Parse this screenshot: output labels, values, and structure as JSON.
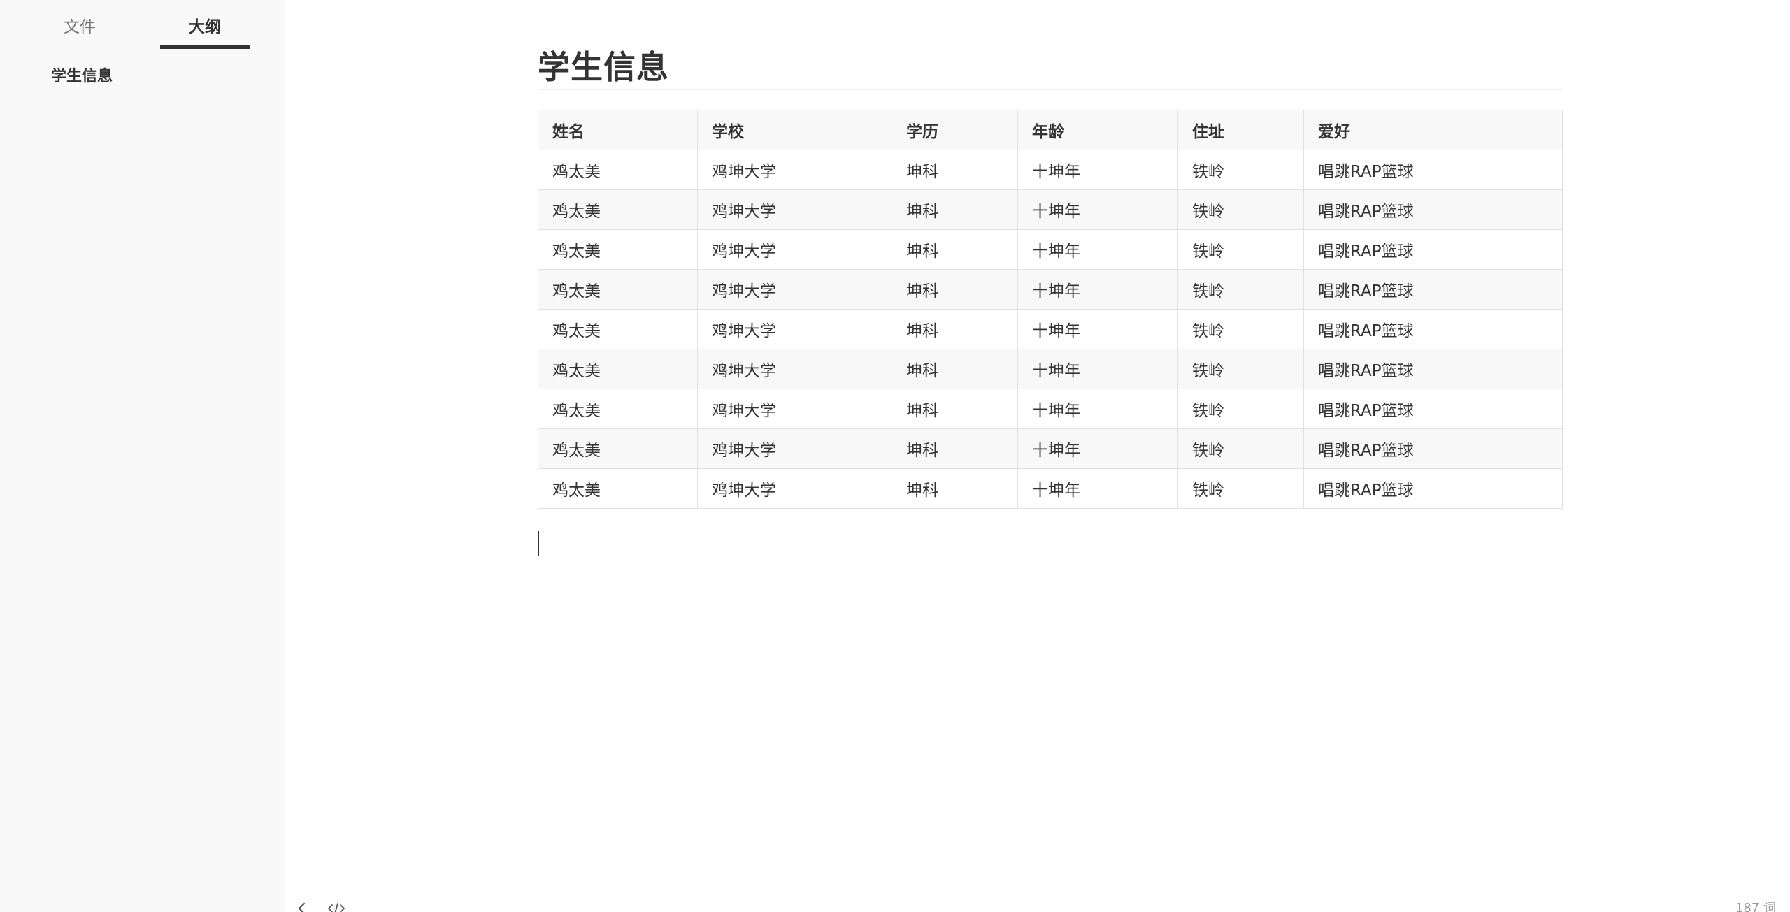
{
  "sidebar": {
    "tabs": [
      {
        "label": "文件",
        "active": false
      },
      {
        "label": "大纲",
        "active": true
      }
    ],
    "outline": [
      {
        "label": "学生信息"
      }
    ]
  },
  "document": {
    "title": "学生信息",
    "table": {
      "headers": [
        "姓名",
        "学校",
        "学历",
        "年龄",
        "住址",
        "爱好"
      ],
      "rows": [
        [
          "鸡太美",
          "鸡坤大学",
          "坤科",
          "十坤年",
          "铁岭",
          "唱跳RAP篮球"
        ],
        [
          "鸡太美",
          "鸡坤大学",
          "坤科",
          "十坤年",
          "铁岭",
          "唱跳RAP篮球"
        ],
        [
          "鸡太美",
          "鸡坤大学",
          "坤科",
          "十坤年",
          "铁岭",
          "唱跳RAP篮球"
        ],
        [
          "鸡太美",
          "鸡坤大学",
          "坤科",
          "十坤年",
          "铁岭",
          "唱跳RAP篮球"
        ],
        [
          "鸡太美",
          "鸡坤大学",
          "坤科",
          "十坤年",
          "铁岭",
          "唱跳RAP篮球"
        ],
        [
          "鸡太美",
          "鸡坤大学",
          "坤科",
          "十坤年",
          "铁岭",
          "唱跳RAP篮球"
        ],
        [
          "鸡太美",
          "鸡坤大学",
          "坤科",
          "十坤年",
          "铁岭",
          "唱跳RAP篮球"
        ],
        [
          "鸡太美",
          "鸡坤大学",
          "坤科",
          "十坤年",
          "铁岭",
          "唱跳RAP篮球"
        ],
        [
          "鸡太美",
          "鸡坤大学",
          "坤科",
          "十坤年",
          "铁岭",
          "唱跳RAP篮球"
        ]
      ]
    }
  },
  "footer": {
    "back_icon": "chevron-left-icon",
    "source_icon": "code-icon",
    "word_count": "187 词"
  },
  "colors": {
    "text": "#333333",
    "sidebar_bg": "#f9f9f9",
    "table_border": "#dfe2e5",
    "table_stripe": "#f8f8f8",
    "muted": "#999999"
  }
}
